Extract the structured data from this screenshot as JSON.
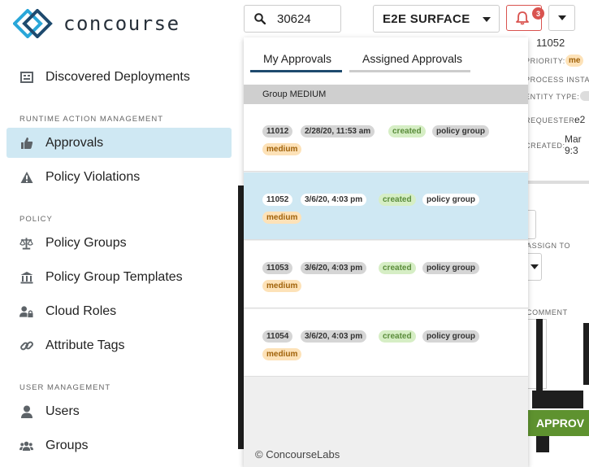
{
  "brand": {
    "name": "concourse"
  },
  "sidebar": {
    "top_items": [
      {
        "label": "Discovered Deployments",
        "icon": "deployments-icon"
      }
    ],
    "sections": [
      {
        "title": "RUNTIME ACTION MANAGEMENT",
        "items": [
          {
            "label": "Approvals",
            "icon": "thumbs-up-icon",
            "active": true
          },
          {
            "label": "Policy Violations",
            "icon": "warning-icon"
          }
        ]
      },
      {
        "title": "POLICY",
        "items": [
          {
            "label": "Policy Groups",
            "icon": "scales-icon"
          },
          {
            "label": "Policy Group Templates",
            "icon": "institution-icon"
          },
          {
            "label": "Cloud Roles",
            "icon": "user-lock-icon"
          },
          {
            "label": "Attribute Tags",
            "icon": "link-icon"
          }
        ]
      },
      {
        "title": "USER MANAGEMENT",
        "items": [
          {
            "label": "Users",
            "icon": "user-icon"
          },
          {
            "label": "Groups",
            "icon": "users-icon"
          }
        ]
      }
    ]
  },
  "topbar": {
    "search_value": "30624",
    "environment": "E2E SURFACE",
    "notification_count": "3"
  },
  "detail_panel": {
    "id": "11052",
    "labels": [
      "PRIORITY:",
      "PROCESS INSTANCE",
      "ENTITY TYPE:",
      "REQUESTER:",
      "CREATED:",
      "ASSIGN TO",
      "COMMENT"
    ],
    "priority_value": "me",
    "requester_value": "e2",
    "created_value": [
      "Mar",
      "9:3"
    ],
    "approve_label": "APPROV"
  },
  "dropdown": {
    "tabs": [
      {
        "label": "My Approvals",
        "active": true
      },
      {
        "label": "Assigned Approvals",
        "active": false
      }
    ],
    "group_header": "Group MEDIUM",
    "approvals": [
      {
        "id": "11012",
        "date": "2/28/20, 11:53 am",
        "status": "created",
        "type": "policy group",
        "priority": "medium",
        "selected": false
      },
      {
        "id": "11052",
        "date": "3/6/20, 4:03 pm",
        "status": "created",
        "type": "policy group",
        "priority": "medium",
        "selected": true
      },
      {
        "id": "11053",
        "date": "3/6/20, 4:03 pm",
        "status": "created",
        "type": "policy group",
        "priority": "medium",
        "selected": false
      },
      {
        "id": "11054",
        "date": "3/6/20, 4:03 pm",
        "status": "created",
        "type": "policy group",
        "priority": "medium",
        "selected": false
      }
    ],
    "footer": "© ConcourseLabs"
  },
  "colors": {
    "accent": "#1e4a6e",
    "active_bg": "#cfe8f3",
    "alert": "#d9534f",
    "approve": "#5e922f"
  }
}
